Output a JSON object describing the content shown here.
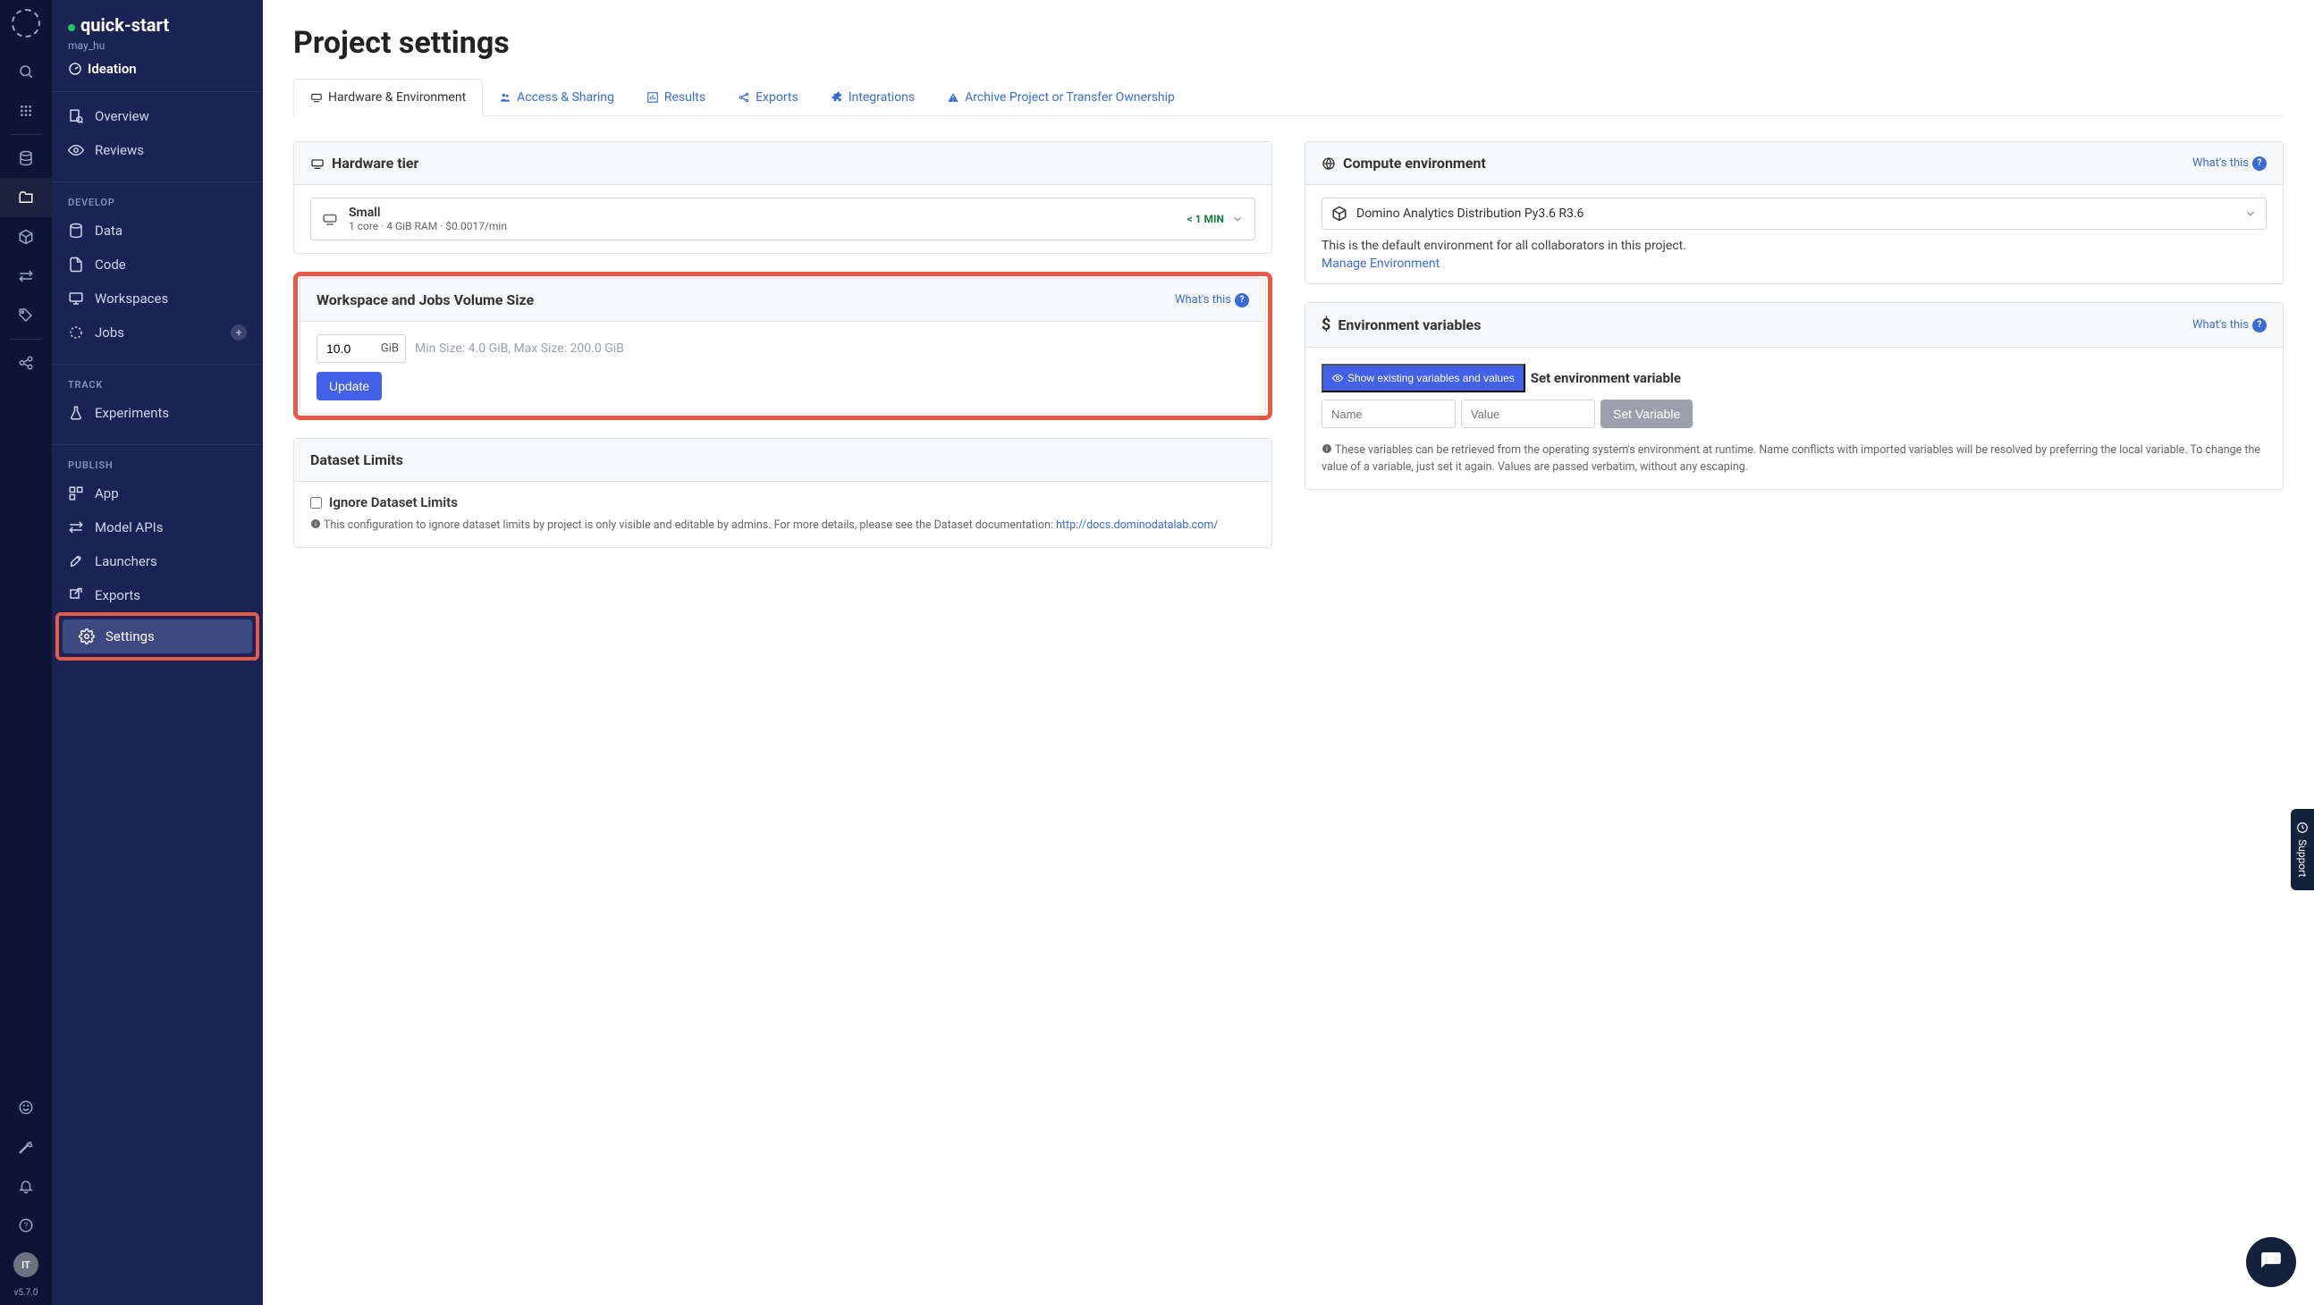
{
  "rail": {
    "avatar": "IT",
    "version": "v5.7.0"
  },
  "sidebar": {
    "project_name": "quick-start",
    "owner": "may_hu",
    "stage": "Ideation",
    "items": {
      "overview": "Overview",
      "reviews": "Reviews"
    },
    "develop_label": "DEVELOP",
    "develop": {
      "data": "Data",
      "code": "Code",
      "workspaces": "Workspaces",
      "jobs": "Jobs"
    },
    "track_label": "TRACK",
    "track": {
      "experiments": "Experiments"
    },
    "publish_label": "PUBLISH",
    "publish": {
      "app": "App",
      "model_apis": "Model APIs",
      "launchers": "Launchers",
      "exports": "Exports",
      "settings": "Settings"
    }
  },
  "page": {
    "title": "Project settings"
  },
  "tabs": {
    "hardware": "Hardware & Environment",
    "access": "Access & Sharing",
    "results": "Results",
    "exports": "Exports",
    "integrations": "Integrations",
    "archive": "Archive Project or Transfer Ownership"
  },
  "hardware_tier": {
    "title": "Hardware tier",
    "selected_name": "Small",
    "selected_meta": "1 core · 4 GiB RAM · $0.0017/min",
    "wait": "< 1 MIN"
  },
  "volume": {
    "title": "Workspace and Jobs Volume Size",
    "whats_this": "What's this",
    "value": "10.0",
    "unit": "GiB",
    "hint": "Min Size: 4.0 GiB, Max Size: 200.0 GiB",
    "update_btn": "Update"
  },
  "dataset_limits": {
    "title": "Dataset Limits",
    "checkbox_label": "Ignore Dataset Limits",
    "note_pre": "This configuration to ignore dataset limits by project is only visible and editable by admins. For more details, please see the Dataset documentation: ",
    "note_link": "http://docs.dominodatalab.com/"
  },
  "compute_env": {
    "title": "Compute environment",
    "whats_this": "What's this",
    "selected": "Domino Analytics Distribution Py3.6 R3.6",
    "desc": "This is the default environment for all collaborators in this project.",
    "manage_link": "Manage Environment"
  },
  "env_vars": {
    "title": "Environment variables",
    "whats_this": "What's this",
    "show_btn": "Show existing variables and values",
    "set_label": "Set environment variable",
    "name_placeholder": "Name",
    "value_placeholder": "Value",
    "set_btn": "Set Variable",
    "note": "These variables can be retrieved from the operating system's environment at runtime. Name conflicts with imported variables will be resolved by preferring the local variable. To change the value of a variable, just set it again. Values are passed verbatim, without any escaping."
  },
  "chat": {
    "support": "Support"
  }
}
